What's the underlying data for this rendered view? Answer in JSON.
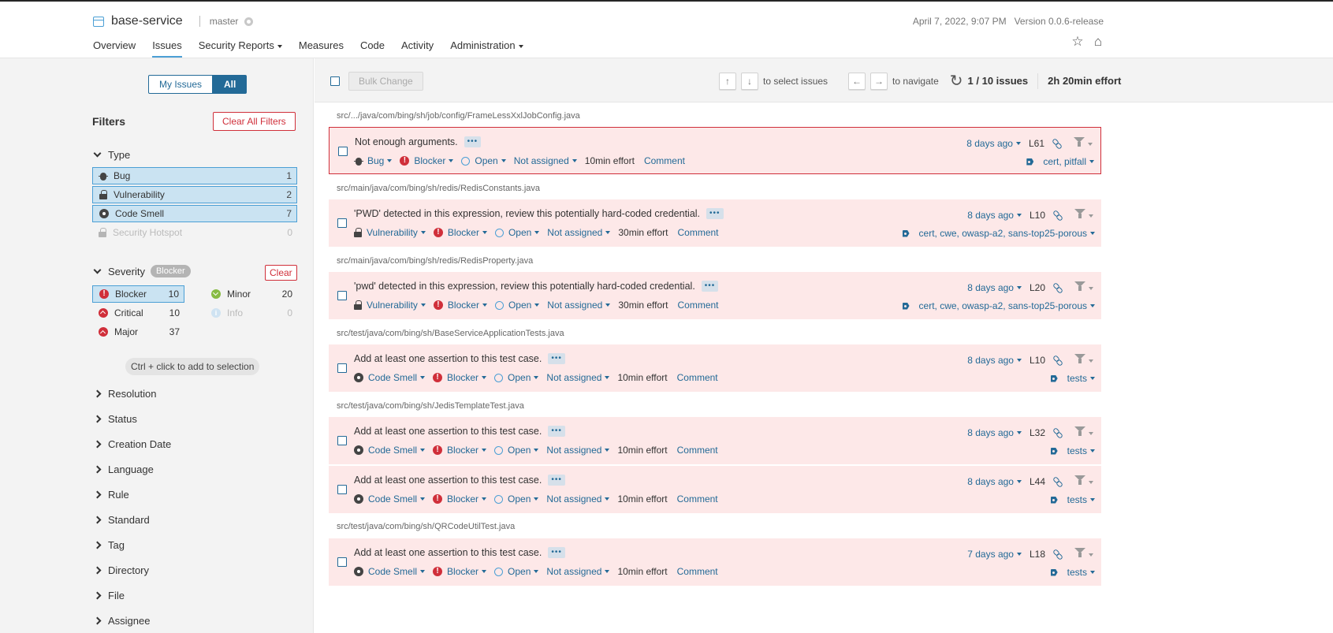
{
  "header": {
    "project": "base-service",
    "branch": "master",
    "date": "April 7, 2022, 9:07 PM",
    "version": "Version 0.0.6-release",
    "nav": [
      {
        "label": "Overview"
      },
      {
        "label": "Issues",
        "active": true
      },
      {
        "label": "Security Reports",
        "dropdown": true
      },
      {
        "label": "Measures"
      },
      {
        "label": "Code"
      },
      {
        "label": "Activity"
      },
      {
        "label": "Administration",
        "dropdown": true
      }
    ]
  },
  "sidebar": {
    "my_issues": "My Issues",
    "all": "All",
    "filters_title": "Filters",
    "clear_all": "Clear All Filters",
    "type": {
      "title": "Type",
      "items": [
        {
          "label": "Bug",
          "count": "1",
          "icon": "bug-icon",
          "selected": true
        },
        {
          "label": "Vulnerability",
          "count": "2",
          "icon": "lock-icon",
          "selected": true
        },
        {
          "label": "Code Smell",
          "count": "7",
          "icon": "code-smell-icon",
          "selected": true
        },
        {
          "label": "Security Hotspot",
          "count": "0",
          "icon": "hotspot-icon",
          "selected": false,
          "disabled": true
        }
      ]
    },
    "severity": {
      "title": "Severity",
      "badge": "Blocker",
      "clear": "Clear",
      "items": [
        {
          "label": "Blocker",
          "count": "10",
          "icon": "blocker-icon",
          "selected": true
        },
        {
          "label": "Minor",
          "count": "20",
          "icon": "minor-icon"
        },
        {
          "label": "Critical",
          "count": "10",
          "icon": "critical-icon"
        },
        {
          "label": "Info",
          "count": "0",
          "icon": "info-icon",
          "disabled": true
        },
        {
          "label": "Major",
          "count": "37",
          "icon": "major-icon"
        }
      ]
    },
    "hint": "Ctrl + click to add to selection",
    "collapsed": [
      "Resolution",
      "Status",
      "Creation Date",
      "Language",
      "Rule",
      "Standard",
      "Tag",
      "Directory",
      "File",
      "Assignee"
    ]
  },
  "toolbar": {
    "bulk_change": "Bulk Change",
    "up": "↑",
    "down": "↓",
    "select_text": "to select issues",
    "left": "←",
    "right": "→",
    "navigate_text": "to navigate",
    "count": "1 / 10 issues",
    "effort": "2h 20min effort"
  },
  "issues": [
    {
      "path": "src/.../java/com/bing/sh/job/config/FrameLessXxlJobConfig.java",
      "message": "Not enough arguments.",
      "type": "Bug",
      "type_icon": "bug-icon",
      "severity": "Blocker",
      "status": "Open",
      "assignee": "Not assigned",
      "effort": "10min effort",
      "comment": "Comment",
      "age": "8 days ago",
      "line": "L61",
      "tags": "cert, pitfall",
      "selected": true
    },
    {
      "path": "src/main/java/com/bing/sh/redis/RedisConstants.java",
      "message": "'PWD' detected in this expression, review this potentially hard-coded credential.",
      "type": "Vulnerability",
      "type_icon": "lock-icon",
      "severity": "Blocker",
      "status": "Open",
      "assignee": "Not assigned",
      "effort": "30min effort",
      "comment": "Comment",
      "age": "8 days ago",
      "line": "L10",
      "tags": "cert, cwe, owasp-a2, sans-top25-porous"
    },
    {
      "path": "src/main/java/com/bing/sh/redis/RedisProperty.java",
      "message": "'pwd' detected in this expression, review this potentially hard-coded credential.",
      "type": "Vulnerability",
      "type_icon": "lock-icon",
      "severity": "Blocker",
      "status": "Open",
      "assignee": "Not assigned",
      "effort": "30min effort",
      "comment": "Comment",
      "age": "8 days ago",
      "line": "L20",
      "tags": "cert, cwe, owasp-a2, sans-top25-porous"
    },
    {
      "path": "src/test/java/com/bing/sh/BaseServiceApplicationTests.java",
      "message": "Add at least one assertion to this test case.",
      "type": "Code Smell",
      "type_icon": "code-smell-icon",
      "severity": "Blocker",
      "status": "Open",
      "assignee": "Not assigned",
      "effort": "10min effort",
      "comment": "Comment",
      "age": "8 days ago",
      "line": "L10",
      "tags": "tests"
    },
    {
      "path": "src/test/java/com/bing/sh/JedisTemplateTest.java",
      "message": "Add at least one assertion to this test case.",
      "type": "Code Smell",
      "type_icon": "code-smell-icon",
      "severity": "Blocker",
      "status": "Open",
      "assignee": "Not assigned",
      "effort": "10min effort",
      "comment": "Comment",
      "age": "8 days ago",
      "line": "L32",
      "tags": "tests"
    },
    {
      "path": "",
      "message": "Add at least one assertion to this test case.",
      "type": "Code Smell",
      "type_icon": "code-smell-icon",
      "severity": "Blocker",
      "status": "Open",
      "assignee": "Not assigned",
      "effort": "10min effort",
      "comment": "Comment",
      "age": "8 days ago",
      "line": "L44",
      "tags": "tests"
    },
    {
      "path": "src/test/java/com/bing/sh/QRCodeUtilTest.java",
      "message": "Add at least one assertion to this test case.",
      "type": "Code Smell",
      "type_icon": "code-smell-icon",
      "severity": "Blocker",
      "status": "Open",
      "assignee": "Not assigned",
      "effort": "10min effort",
      "comment": "Comment",
      "age": "7 days ago",
      "line": "L18",
      "tags": "tests"
    }
  ]
}
